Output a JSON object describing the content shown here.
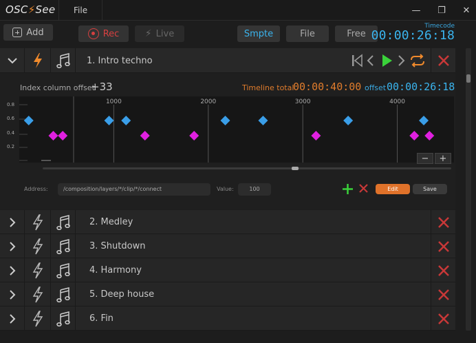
{
  "app": {
    "logo_left": "OSC",
    "logo_right": "See",
    "menu_file": "File"
  },
  "window": {
    "minimize": "—",
    "restore": "❐",
    "close": "✕"
  },
  "toolbar": {
    "add_label": "Add",
    "rec_label": "Rec",
    "live_label": "Live",
    "mode_smpte": "Smpte",
    "mode_file": "File",
    "mode_free": "Free",
    "timecode_label": "Timecode",
    "timecode_value": "00:00:26:18"
  },
  "expanded_track": {
    "name": "1. Intro techno",
    "index_offset_label": "Index column offset",
    "index_offset_value": "+33",
    "timeline_total_label": "Timeline total",
    "timeline_total_value": "00:00:40:00",
    "offset_label": "offset",
    "offset_value": "00:00:26:18",
    "address_label": "Address:",
    "address_value": "/composition/layers/*/clip/*/connect",
    "value_label": "Value:",
    "value_value": "100",
    "edit_label": "Edit",
    "save_label": "Save",
    "zoom_out": "−",
    "zoom_in": "+"
  },
  "chart_data": {
    "type": "scatter",
    "x_ticks": [
      "1000",
      "2000",
      "3000",
      "4000"
    ],
    "y_ticks": [
      "0.8",
      "0.6",
      "0.4",
      "0.2"
    ],
    "xlim": [
      0,
      4600
    ],
    "ylim": [
      0,
      1.0
    ],
    "series": [
      {
        "color": "#3a9ee8",
        "points": [
          [
            100,
            0.6
          ],
          [
            950,
            0.6
          ],
          [
            1130,
            0.6
          ],
          [
            2180,
            0.6
          ],
          [
            2580,
            0.6
          ],
          [
            3480,
            0.6
          ],
          [
            4280,
            0.6
          ]
        ]
      },
      {
        "color": "#e020e0",
        "points": [
          [
            360,
            0.4
          ],
          [
            460,
            0.4
          ],
          [
            1330,
            0.4
          ],
          [
            1850,
            0.4
          ],
          [
            3140,
            0.4
          ],
          [
            4180,
            0.4
          ],
          [
            4340,
            0.4
          ]
        ]
      }
    ]
  },
  "tracks": [
    {
      "name": "2. Medley"
    },
    {
      "name": "3. Shutdown"
    },
    {
      "name": "4. Harmony"
    },
    {
      "name": "5. Deep house"
    },
    {
      "name": "6. Fin"
    }
  ],
  "colors": {
    "accent_orange": "#e07c2c",
    "accent_blue": "#3ab4ee",
    "delete_red": "#c83838",
    "play_green": "#3ad23a"
  }
}
